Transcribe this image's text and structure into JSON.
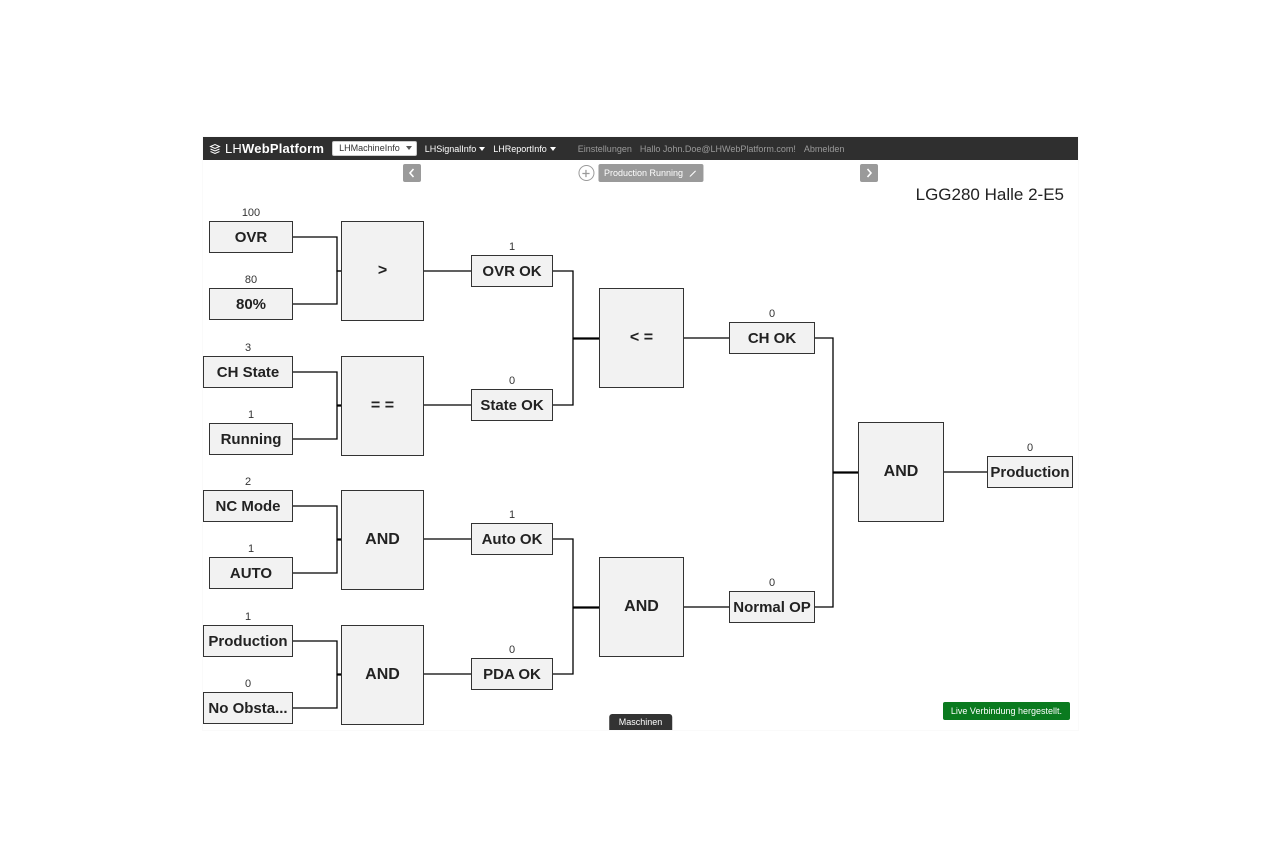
{
  "brand": {
    "prefix": "LH",
    "main": "WebPlatform"
  },
  "nav": {
    "select": "LHMachineInfo",
    "signal": "LHSignalInfo",
    "report": "LHReportInfo",
    "settings": "Einstellungen",
    "greeting": "Hallo John.Doe@LHWebPlatform.com!",
    "logout": "Abmelden"
  },
  "toolbar": {
    "chip": "Production Running"
  },
  "title": "LGG280 Halle 2-E5",
  "bottomTab": "Maschinen",
  "liveStatus": "Live Verbindung hergestellt.",
  "nodes": {
    "ovr": {
      "label": "OVR",
      "val": "100"
    },
    "p80": {
      "label": "80%",
      "val": "80"
    },
    "gt": {
      "label": ">"
    },
    "ovrok": {
      "label": "OVR OK",
      "val": "1"
    },
    "chstate": {
      "label": "CH State",
      "val": "3"
    },
    "running": {
      "label": "Running",
      "val": "1"
    },
    "eq": {
      "label": "= ="
    },
    "stateok": {
      "label": "State OK",
      "val": "0"
    },
    "lte": {
      "label": "< ="
    },
    "chok": {
      "label": "CH OK",
      "val": "0"
    },
    "ncmode": {
      "label": "NC Mode",
      "val": "2"
    },
    "auto": {
      "label": "AUTO",
      "val": "1"
    },
    "and1": {
      "label": "AND"
    },
    "autook": {
      "label": "Auto OK",
      "val": "1"
    },
    "prodin": {
      "label": "Production",
      "val": "1"
    },
    "noobst": {
      "label": "No Obsta...",
      "val": "0"
    },
    "and2": {
      "label": "AND"
    },
    "pdaok": {
      "label": "PDA OK",
      "val": "0"
    },
    "and3": {
      "label": "AND"
    },
    "normalop": {
      "label": "Normal OP",
      "val": "0"
    },
    "andf": {
      "label": "AND"
    },
    "prodout": {
      "label": "Production",
      "val": "0"
    }
  }
}
